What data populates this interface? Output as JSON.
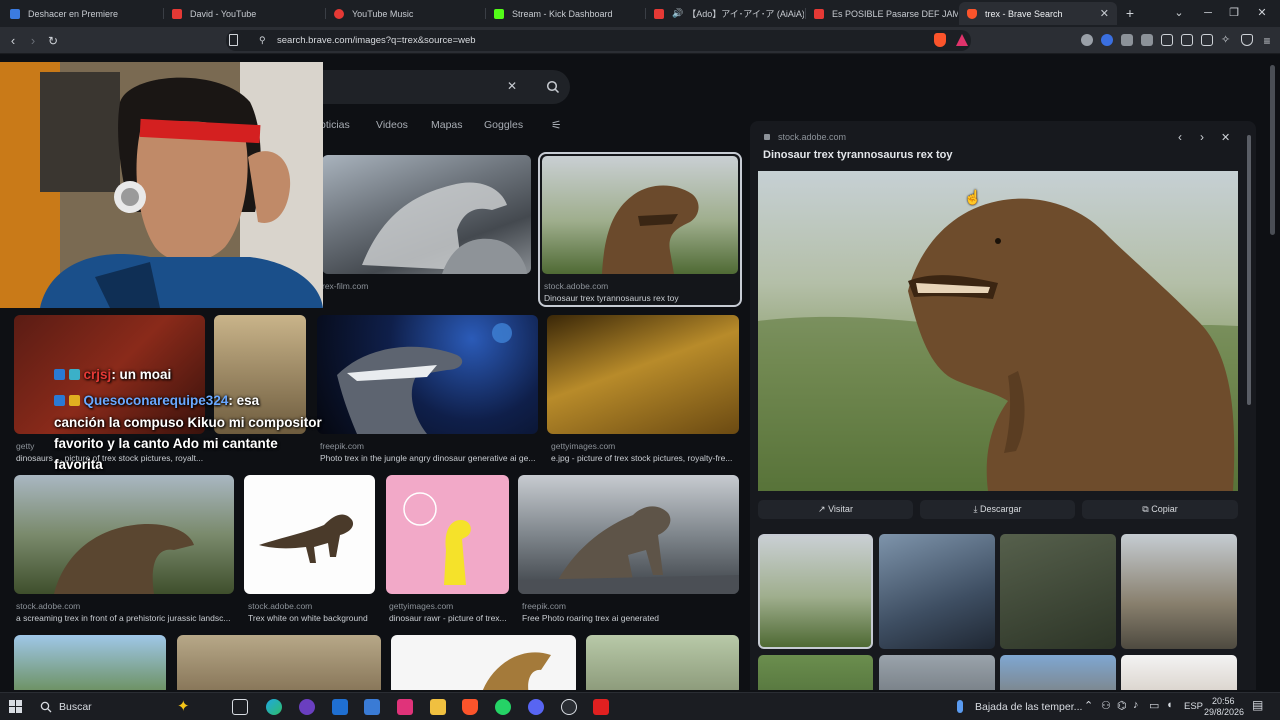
{
  "browser": {
    "tabs": [
      {
        "label": "Deshacer en Premiere",
        "color": "#3b7be0"
      },
      {
        "label": "David - YouTube",
        "color": "#e53935"
      },
      {
        "label": "YouTube Music",
        "color": "#e53935"
      },
      {
        "label": "Stream - Kick Dashboard",
        "color": "#53fc18"
      },
      {
        "label": "【Ado】アイ･アイ･ア (AiAiA) - Yo",
        "color": "#e53935"
      },
      {
        "label": "Es POSIBLE Pasarse DEF JAM de la P",
        "color": "#e53935"
      },
      {
        "label": "trex - Brave Search",
        "color": "#fb542b"
      }
    ],
    "url": "search.brave.com/images?q=trex&source=web"
  },
  "search": {
    "tabs": [
      "oticias",
      "Videos",
      "Mapas",
      "Goggles"
    ]
  },
  "results": {
    "row1": [
      {
        "source": "rex-film.com",
        "title": ""
      },
      {
        "source": "stock.adobe.com",
        "title": "Dinosaur trex tyrannosaurus rex toy"
      }
    ],
    "row2": [
      {
        "source": "getty",
        "title": "dinosaurs ... picture of trex stock pictures, royalt..."
      },
      {
        "source": "freepik.com",
        "title": "Photo trex in the jungle angry dinosaur generative ai ge..."
      },
      {
        "source": "gettyimages.com",
        "title": "e.jpg - picture of trex stock pictures, royalty-fre..."
      }
    ],
    "row3": [
      {
        "source": "stock.adobe.com",
        "title": "a screaming trex in front of a prehistoric jurassic landsc..."
      },
      {
        "source": "stock.adobe.com",
        "title": "Trex white on white background"
      },
      {
        "source": "gettyimages.com",
        "title": "dinosaur rawr - picture of trex..."
      },
      {
        "source": "freepik.com",
        "title": "Free Photo roaring trex ai generated"
      }
    ]
  },
  "chat": [
    {
      "name": "crjsj",
      "message": ": un moai"
    },
    {
      "name": "Quesoconarequipe324",
      "message": ": esa",
      "cont1": "canción la compuso Kikuo mi compositor",
      "cont2": "favorito y la canto Ado mi cantante",
      "cont3": "favorita"
    }
  ],
  "panel": {
    "source": "stock.adobe.com",
    "title": "Dinosaur trex tyrannosaurus rex toy",
    "visit": "Visitar",
    "download": "Descargar",
    "copy": "Copiar"
  },
  "taskbar": {
    "search": "Buscar",
    "weather": "Bajada de las temper...",
    "lang": "ESP",
    "time": "20:56",
    "date": "29/8/2026"
  }
}
